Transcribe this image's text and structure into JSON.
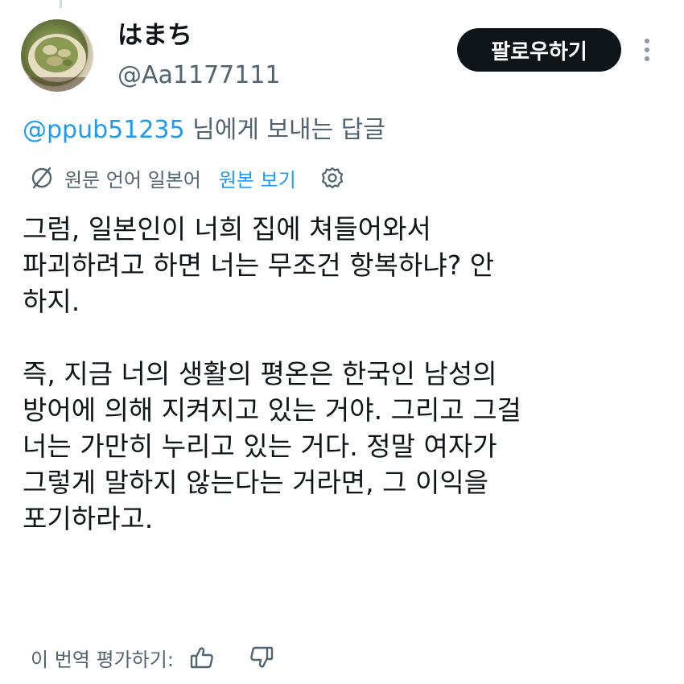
{
  "author": {
    "display_name": "はまち",
    "handle": "@Aa1177111"
  },
  "follow_button_label": "팔로우하기",
  "reply_context": {
    "mention": "@ppub51235",
    "suffix": " 님에게 보내는 답글"
  },
  "translation": {
    "source_language_label": "원문 언어 일본어",
    "show_original_label": "원본 보기"
  },
  "tweet_paragraphs": [
    "그럼, 일본인이 너희 집에 쳐들어와서\n파괴하려고 하면 너는 무조건 항복하냐? 안\n하지.",
    "즉, 지금 너의 생활의 평온은 한국인 남성의\n방어에 의해 지켜지고 있는 거야. 그리고 그걸\n너는 가만히 누리고 있는 거다. 정말 여자가\n그렇게 말하지 않는다는 거라면, 그 이익을\n포기하라고."
  ],
  "rate_translation_label": "이 번역 평가하기:",
  "colors": {
    "accent": "#1d9bf0",
    "follow_button_bg": "#0f1419",
    "secondary_text": "#536471"
  },
  "icons": {
    "more": "more-vertical-icon",
    "translate": "translate-icon",
    "settings": "gear-icon",
    "thumbs_up": "thumbs-up-icon",
    "thumbs_down": "thumbs-down-icon"
  }
}
